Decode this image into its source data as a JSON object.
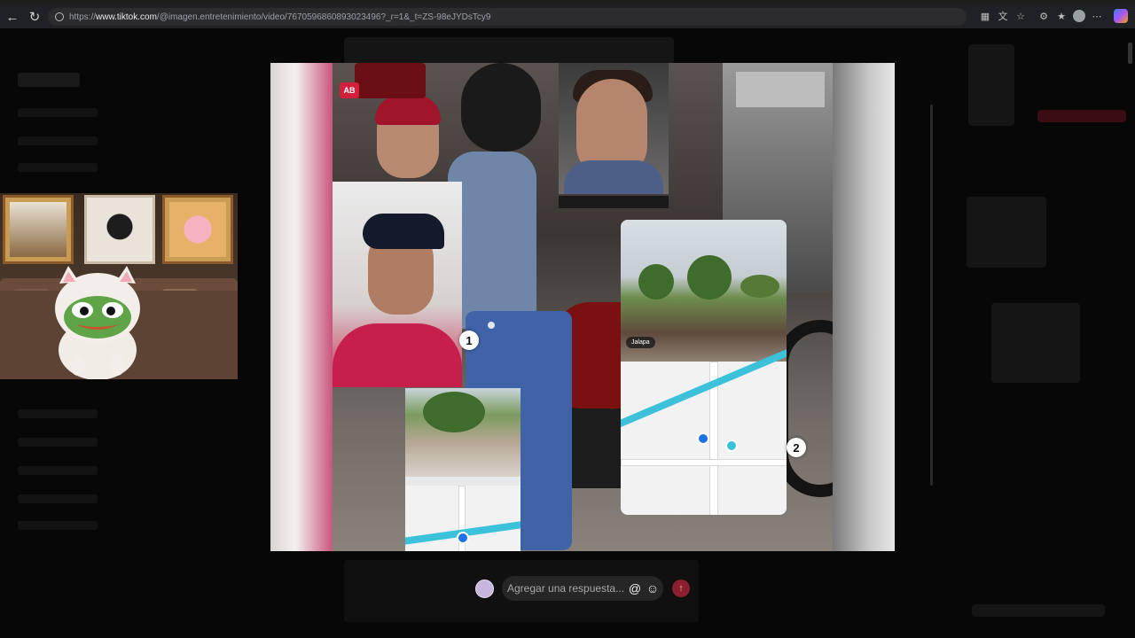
{
  "browser": {
    "url_prefix": "https://",
    "url_domain": "www.tiktok.com",
    "url_path": "/@imagen.entretenimiento/video/7670596860893023496?_r=1&_t=ZS-98eJYDsTcy9"
  },
  "viewer": {
    "sticker_label": "AB",
    "numbered_marker_1": "1",
    "numbered_marker_2": "2",
    "card_caption": "Jalapa"
  },
  "reply": {
    "placeholder": "Agregar una respuesta..."
  },
  "colors": {
    "send_button": "#8b1e2f",
    "route": "#3bc1d9",
    "accent_red": "#c61f4c"
  }
}
